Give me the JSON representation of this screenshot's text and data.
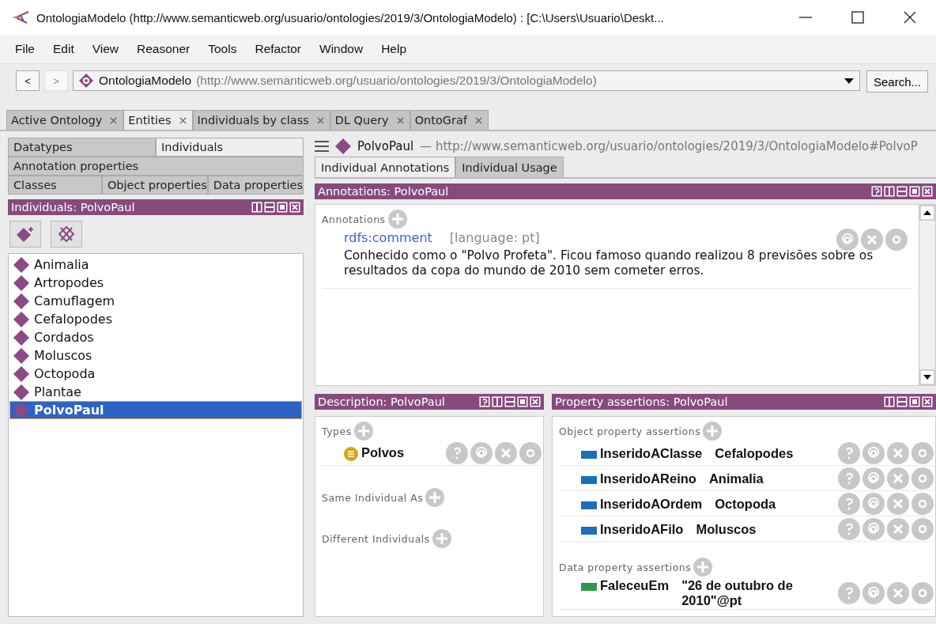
{
  "window": {
    "title": "OntologiaModelo (http://www.semanticweb.org/usuario/ontologies/2019/3/OntologiaModelo)  : [C:\\Users\\Usuario\\Deskt..."
  },
  "menu": [
    "File",
    "Edit",
    "View",
    "Reasoner",
    "Tools",
    "Refactor",
    "Window",
    "Help"
  ],
  "nav": {
    "back": {
      "label": "<",
      "disabled": false
    },
    "forward": {
      "label": ">",
      "disabled": true
    },
    "address": {
      "name": "OntologiaModelo",
      "iri": "(http://www.semanticweb.org/usuario/ontologies/2019/3/OntologiaModelo)"
    },
    "search_button": "Search..."
  },
  "tabs": [
    {
      "label": "Active Ontology",
      "selected": false
    },
    {
      "label": "Entities",
      "selected": true
    },
    {
      "label": "Individuals by class",
      "selected": false
    },
    {
      "label": "DL Query",
      "selected": false
    },
    {
      "label": "OntoGraf",
      "selected": false
    }
  ],
  "entity_tabs": [
    [
      {
        "label": "Datatypes",
        "selected": false
      },
      {
        "label": "Individuals",
        "selected": true
      }
    ],
    [
      {
        "label": "Annotation properties",
        "selected": false
      }
    ],
    [
      {
        "label": "Classes",
        "selected": false
      },
      {
        "label": "Object properties",
        "selected": false
      },
      {
        "label": "Data properties",
        "selected": false
      }
    ]
  ],
  "individuals_panel": {
    "title": "Individuals: PolvoPaul",
    "items": [
      {
        "label": "Animalia",
        "selected": false
      },
      {
        "label": "Artropodes",
        "selected": false
      },
      {
        "label": "Camuflagem",
        "selected": false
      },
      {
        "label": "Cefalopodes",
        "selected": false
      },
      {
        "label": "Cordados",
        "selected": false
      },
      {
        "label": "Moluscos",
        "selected": false
      },
      {
        "label": "Octopoda",
        "selected": false
      },
      {
        "label": "Plantae",
        "selected": false
      },
      {
        "label": "PolvoPaul",
        "selected": true
      }
    ]
  },
  "entity_header": {
    "name": "PolvoPaul",
    "iri": "— http://www.semanticweb.org/usuario/ontologies/2019/3/OntologiaModelo#PolvoP"
  },
  "sub_tabs": [
    {
      "label": "Individual Annotations",
      "selected": true
    },
    {
      "label": "Individual Usage",
      "selected": false
    }
  ],
  "annotations_panel": {
    "title": "Annotations: PolvoPaul",
    "section": "Annotations",
    "items": [
      {
        "property": "rdfs:comment",
        "language": "[language: pt]",
        "value": "Conhecido como o \"Polvo Profeta\". Ficou famoso quando realizou 8 previsões sobre os resultados da copa do mundo de 2010 sem cometer erros."
      }
    ]
  },
  "description_panel": {
    "title": "Description: PolvoPaul",
    "sections": [
      {
        "label": "Types",
        "items": [
          {
            "label": "Polvos"
          }
        ]
      },
      {
        "label": "Same Individual As"
      },
      {
        "label": "Different Individuals"
      }
    ]
  },
  "property_panel": {
    "title": "Property assertions: PolvoPaul",
    "sections": [
      {
        "label": "Object property assertions",
        "kind": "object",
        "items": [
          {
            "property": "InseridoAClasse",
            "value": "Cefalopodes"
          },
          {
            "property": "InseridoAReino",
            "value": "Animalia"
          },
          {
            "property": "InseridoAOrdem",
            "value": "Octopoda"
          },
          {
            "property": "InseridoAFilo",
            "value": "Moluscos"
          }
        ]
      },
      {
        "label": "Data property assertions",
        "kind": "data",
        "items": [
          {
            "property": "FaleceuEm",
            "value": "\"26 de outubro de 2010\"@pt"
          }
        ]
      }
    ]
  }
}
